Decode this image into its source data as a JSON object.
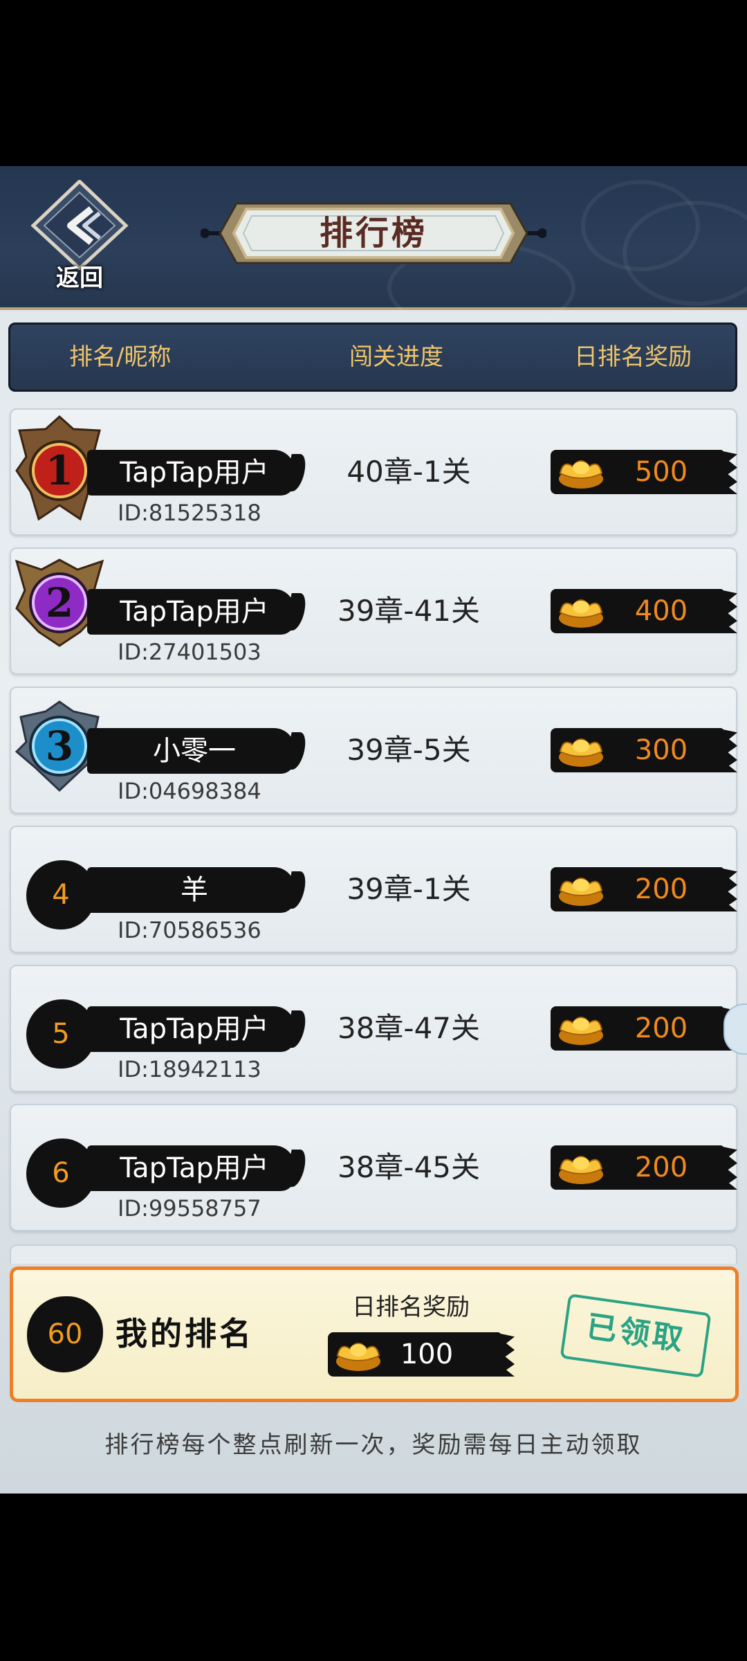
{
  "header": {
    "back_label": "返回",
    "title": "排行榜"
  },
  "columns": {
    "rank_name": "排名/昵称",
    "progress": "闯关进度",
    "reward": "日排名奖励"
  },
  "rows": [
    {
      "rank": "1",
      "nickname": "TapTap用户",
      "uid": "ID:81525318",
      "progress": "40章-1关",
      "reward": "500",
      "medal_color": "#c0201a"
    },
    {
      "rank": "2",
      "nickname": "TapTap用户",
      "uid": "ID:27401503",
      "progress": "39章-41关",
      "reward": "400",
      "medal_color": "#8e2bc4"
    },
    {
      "rank": "3",
      "nickname": "小零一",
      "uid": "ID:04698384",
      "progress": "39章-5关",
      "reward": "300",
      "medal_color": "#1d8ec9"
    },
    {
      "rank": "4",
      "nickname": "羊",
      "uid": "ID:70586536",
      "progress": "39章-1关",
      "reward": "200"
    },
    {
      "rank": "5",
      "nickname": "TapTap用户",
      "uid": "ID:18942113",
      "progress": "38章-47关",
      "reward": "200"
    },
    {
      "rank": "6",
      "nickname": "TapTap用户",
      "uid": "ID:99558757",
      "progress": "38章-45关",
      "reward": "200"
    }
  ],
  "my_rank": {
    "rank": "60",
    "label": "我的排名",
    "reward_title": "日排名奖励",
    "reward": "100",
    "status": "已领取"
  },
  "footer": "排行榜每个整点刷新一次，奖励需每日主动领取",
  "colors": {
    "accent_orange": "#f08a1c",
    "header_navy": "#26374f",
    "column_gold": "#f0c46a",
    "stamp_green": "#2aa384"
  },
  "icons": {
    "back": "back-arrow-icon",
    "reward": "gold-ingot-icon"
  }
}
